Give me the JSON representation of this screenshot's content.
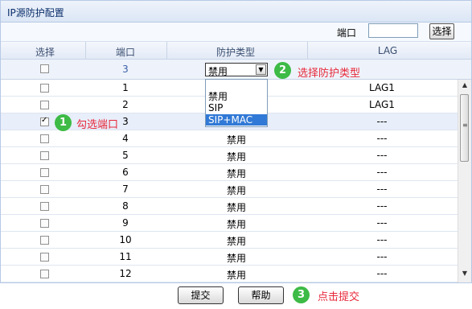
{
  "window": {
    "title": "IP源防护配置"
  },
  "search": {
    "label": "端口",
    "value": "",
    "button": "选择"
  },
  "columns": {
    "select": "选择",
    "port": "端口",
    "type": "防护类型",
    "lag": "LAG"
  },
  "edit_row": {
    "port": "3",
    "select_value": "禁用"
  },
  "dropdown": {
    "options": [
      "",
      "禁用",
      "SIP",
      "SIP+MAC"
    ],
    "selected": "SIP+MAC"
  },
  "rows": [
    {
      "port": "1",
      "type": "",
      "lag": "LAG1",
      "checked": false
    },
    {
      "port": "2",
      "type": "",
      "lag": "LAG1",
      "checked": false
    },
    {
      "port": "3",
      "type": "",
      "lag": "---",
      "checked": true
    },
    {
      "port": "4",
      "type": "禁用",
      "lag": "---",
      "checked": false
    },
    {
      "port": "5",
      "type": "禁用",
      "lag": "---",
      "checked": false
    },
    {
      "port": "6",
      "type": "禁用",
      "lag": "---",
      "checked": false
    },
    {
      "port": "7",
      "type": "禁用",
      "lag": "---",
      "checked": false
    },
    {
      "port": "8",
      "type": "禁用",
      "lag": "---",
      "checked": false
    },
    {
      "port": "9",
      "type": "禁用",
      "lag": "---",
      "checked": false
    },
    {
      "port": "10",
      "type": "禁用",
      "lag": "---",
      "checked": false
    },
    {
      "port": "11",
      "type": "禁用",
      "lag": "---",
      "checked": false
    },
    {
      "port": "12",
      "type": "禁用",
      "lag": "---",
      "checked": false
    }
  ],
  "annotations": [
    {
      "num": "1",
      "text": "勾选端口"
    },
    {
      "num": "2",
      "text": "选择防护类型"
    },
    {
      "num": "3",
      "text": "点击提交"
    }
  ],
  "buttons": {
    "submit": "提交",
    "help": "帮助"
  },
  "colors": {
    "annotation": "#e8283a",
    "badge": "#3dbb46",
    "selected_option": "#3179d6"
  },
  "icons": {
    "dropdown_arrow": "chevron-down-icon",
    "scroll_up": "arrow-up-icon",
    "scroll_down": "arrow-down-icon"
  }
}
